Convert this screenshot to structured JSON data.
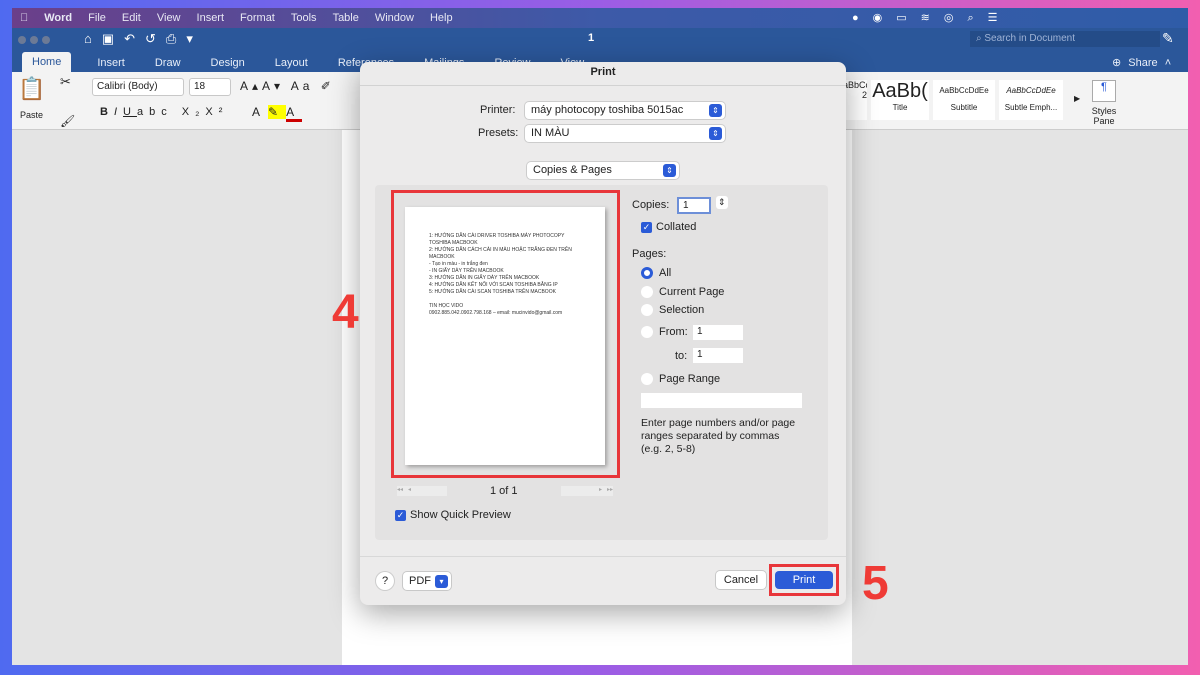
{
  "menubar": {
    "app": "Word",
    "items": [
      "File",
      "Edit",
      "View",
      "Insert",
      "Format",
      "Tools",
      "Table",
      "Window",
      "Help"
    ]
  },
  "titlebar": {
    "doc_title": "1",
    "search_placeholder": "Search in Document"
  },
  "tabs": [
    "Home",
    "Insert",
    "Draw",
    "Design",
    "Layout",
    "References",
    "Mailings",
    "Review",
    "View"
  ],
  "share_label": "Share",
  "ribbon": {
    "paste": "Paste",
    "font": "Calibri (Body)",
    "size": "18",
    "styles": [
      {
        "sample": "AaBbCcDdEe",
        "name": "2"
      },
      {
        "sample": "AaBb(",
        "name": "Title"
      },
      {
        "sample": "AaBbCcDdEe",
        "name": "Subtitle"
      },
      {
        "sample": "AaBbCcDdEe",
        "name": "Subtle Emph..."
      }
    ],
    "styles_pane": "Styles Pane"
  },
  "dialog": {
    "title": "Print",
    "printer_label": "Printer:",
    "printer": "máy photocopy toshiba 5015ac",
    "presets_label": "Presets:",
    "presets": "IN MÀU",
    "section": "Copies & Pages",
    "preview_lines": [
      "1: HƯỚNG DẪN CÀI DRIVER TOSHIBA MÁY PHOTOCOPY",
      "TOSHIBA MACBOOK",
      "2: HƯỚNG DẪN CÁCH CÀI IN MÀU HOẶC TRẮNG ĐEN TRÊN",
      "MACBOOK",
      "- Tạo in màu - in trắng đen",
      "- IN GIẤY DÀY TRÊN MACBOOK",
      "3: HƯỚNG DẪN IN GIẤY DÀY TRÊN MACBOOK",
      "4: HƯỚNG DẪN KẾT NỐI VỚI SCAN TOSHIBA BẰNG IP",
      "5: HƯỚNG DẪN CÀI SCAN TOSHIBA TRÊN MACBOOK",
      "",
      "TIN HỌC VIDO",
      "0902.885.042.0902.798.168 – email: mucinvido@gmail.com"
    ],
    "page_counter": "1 of 1",
    "show_quick_preview": "Show Quick Preview",
    "copies_label": "Copies:",
    "copies": "1",
    "collated": "Collated",
    "pages_label": "Pages:",
    "opt_all": "All",
    "opt_current": "Current Page",
    "opt_selection": "Selection",
    "opt_from": "From:",
    "from": "1",
    "to_label": "to:",
    "to": "1",
    "opt_range": "Page Range",
    "range_hint": "Enter page numbers and/or page ranges separated by commas (e.g. 2, 5-8)",
    "help": "?",
    "pdf": "PDF",
    "cancel": "Cancel",
    "print": "Print"
  },
  "annotations": {
    "step4": "4",
    "step5": "5"
  },
  "colors": {
    "word_blue": "#2b579a",
    "accent": "#2b5bd7",
    "annotation_red": "#e8363a"
  }
}
